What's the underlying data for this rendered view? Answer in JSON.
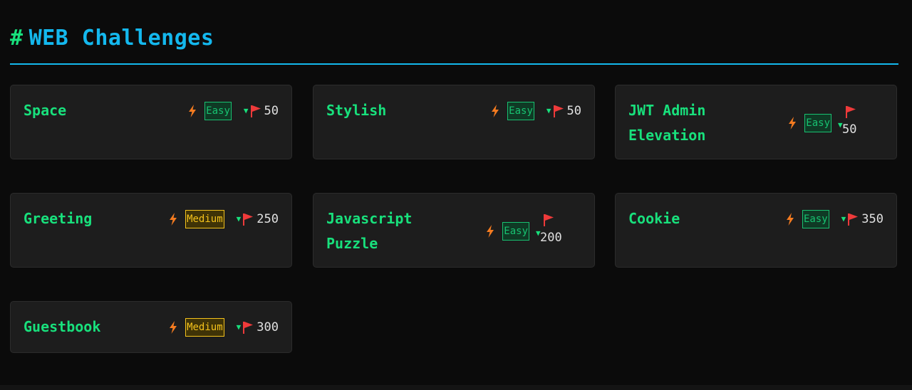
{
  "header": {
    "hash": "#",
    "title": "WEB Challenges"
  },
  "colors": {
    "accent_green": "#18e07c",
    "accent_blue": "#14b8ee",
    "easy": "#18c271",
    "medium": "#f4c21c",
    "bolt": "#f47b20",
    "flag": "#ee3a3a"
  },
  "icons": {
    "difficulty": "lightning-bolt-icon",
    "points": "red-flag-icon",
    "indicator": "triangle-down-icon"
  },
  "challenges": [
    {
      "name": "Space",
      "difficulty": "Easy",
      "points": "50"
    },
    {
      "name": "Stylish",
      "difficulty": "Easy",
      "points": "50"
    },
    {
      "name": "JWT Admin Elevation",
      "difficulty": "Easy",
      "points": "50"
    },
    {
      "name": "Greeting",
      "difficulty": "Medium",
      "points": "250"
    },
    {
      "name": "Javascript Puzzle",
      "difficulty": "Easy",
      "points": "200"
    },
    {
      "name": "Cookie",
      "difficulty": "Easy",
      "points": "350"
    },
    {
      "name": "Guestbook",
      "difficulty": "Medium",
      "points": "300"
    }
  ]
}
